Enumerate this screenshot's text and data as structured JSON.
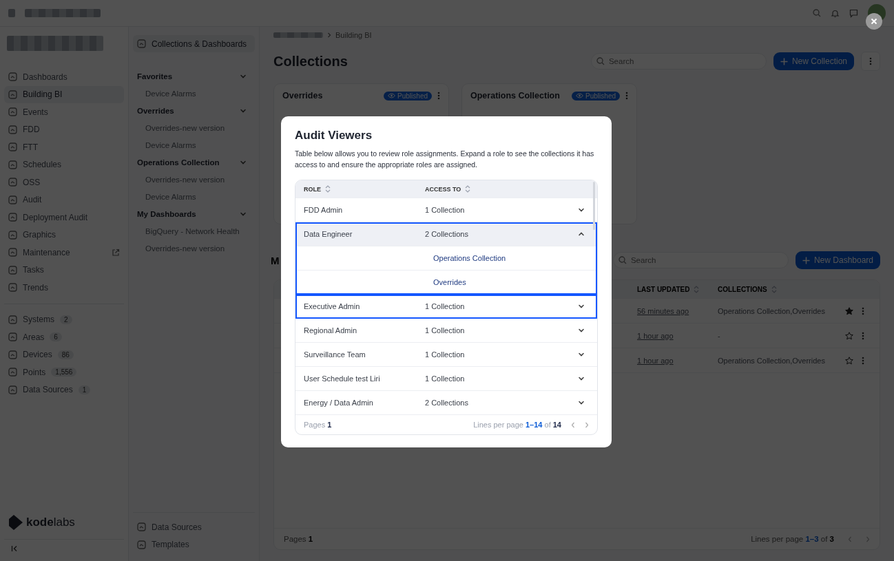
{
  "sidebar": {
    "items": [
      {
        "label": "Dashboards",
        "selected": false,
        "external": false
      },
      {
        "label": "Building BI",
        "selected": true,
        "external": false
      },
      {
        "label": "Events",
        "selected": false,
        "external": false
      },
      {
        "label": "FDD",
        "selected": false,
        "external": false
      },
      {
        "label": "FTT",
        "selected": false,
        "external": false
      },
      {
        "label": "Schedules",
        "selected": false,
        "external": false
      },
      {
        "label": "OSS",
        "selected": false,
        "external": false
      },
      {
        "label": "Audit",
        "selected": false,
        "external": false
      },
      {
        "label": "Deployment Audit",
        "selected": false,
        "external": false
      },
      {
        "label": "Graphics",
        "selected": false,
        "external": false
      },
      {
        "label": "Maintenance",
        "selected": false,
        "external": true
      },
      {
        "label": "Tasks",
        "selected": false,
        "external": false
      },
      {
        "label": "Trends",
        "selected": false,
        "external": false
      }
    ],
    "counted": [
      {
        "label": "Systems",
        "count": "2"
      },
      {
        "label": "Areas",
        "count": "6"
      },
      {
        "label": "Devices",
        "count": "86"
      },
      {
        "label": "Points",
        "count": "1,556"
      },
      {
        "label": "Data Sources",
        "count": "1"
      }
    ],
    "brand": "**kode**labs"
  },
  "panel": {
    "header": "Collections & Dashboards",
    "groups": [
      {
        "title": "Favorites",
        "expanded": true,
        "items": [
          "Device Alarms"
        ]
      },
      {
        "title": "Overrides",
        "expanded": true,
        "items": [
          "Overrides-new version",
          "Device Alarms"
        ]
      },
      {
        "title": "Operations Collection",
        "expanded": true,
        "items": [
          "Overrides-new version",
          "Device Alarms"
        ]
      },
      {
        "title": "My Dashboards",
        "expanded": true,
        "items": [
          "BigQuery - Network Health",
          "Overrides-new version"
        ]
      }
    ],
    "footer_links": [
      "Data Sources",
      "Templates"
    ]
  },
  "breadcrumb": {
    "current": "Building BI"
  },
  "page_title": "Collections",
  "search": {
    "placeholder": "Search"
  },
  "new_button": "New Collection",
  "cards": [
    {
      "title": "Overrides",
      "badge": "Published"
    },
    {
      "title": "Operations Collection",
      "badge": "Published"
    }
  ],
  "dashboards": {
    "heading": "M",
    "search": {
      "placeholder": "Search"
    },
    "new_button": "New Dashboard",
    "columns": [
      "LAST UPDATED",
      "COLLECTIONS"
    ],
    "rows": [
      {
        "last_updated": "56 minutes ago",
        "collections": "Operations Collection,Overrides",
        "favorite": true
      },
      {
        "last_updated": "1 hour ago",
        "collections": "-",
        "favorite": false
      },
      {
        "last_updated": "1 hour ago",
        "collections": "Operations Collection,Overrides",
        "favorite": false
      }
    ],
    "lines": "Lines per page **1–3** of **3**",
    "pages": "Pages **1**"
  },
  "modal": {
    "title": "Audit Viewers",
    "description": "Table below allows you to review role assignments. Expand a role to see the collections it has access to and ensure the appropriate roles are assigned.",
    "columns": [
      "ROLE",
      "ACCESS TO"
    ],
    "rows": [
      {
        "role": "FDD Admin",
        "access": "1 Collection",
        "expanded": false,
        "highlighted": false
      },
      {
        "role": "Data Engineer",
        "access": "2 Collections",
        "expanded": true,
        "highlighted": true,
        "children": [
          "Operations Collection",
          "Overrides"
        ]
      },
      {
        "role": "Executive Admin",
        "access": "1 Collection",
        "expanded": false,
        "highlighted": true
      },
      {
        "role": "Regional Admin",
        "access": "1 Collection",
        "expanded": false,
        "highlighted": false
      },
      {
        "role": "Surveillance Team",
        "access": "1 Collection",
        "expanded": false,
        "highlighted": false
      },
      {
        "role": "User Schedule test Liri",
        "access": "1 Collection",
        "expanded": false,
        "highlighted": false
      },
      {
        "role": "Energy / Data Admin",
        "access": "2 Collections",
        "expanded": false,
        "highlighted": false
      }
    ],
    "pages": "Pages **1**",
    "lines": "Lines per page **1–14** of **14**"
  }
}
